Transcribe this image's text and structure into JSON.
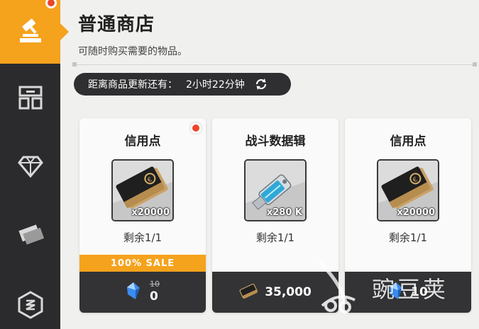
{
  "sidebar": {
    "items": [
      {
        "icon": "bid-hammer-icon",
        "active": true,
        "has_notification": true
      },
      {
        "icon": "store-icon",
        "active": false
      },
      {
        "icon": "diamond-icon",
        "active": false
      },
      {
        "icon": "tickets-icon",
        "active": false
      },
      {
        "icon": "hex-badge-icon",
        "active": false
      }
    ]
  },
  "header": {
    "title": "普通商店",
    "subtitle": "可随时购买需要的物品。"
  },
  "timer": {
    "label": "距离商品更新还有：",
    "value": "2小时22分钟",
    "icon": "refresh-icon"
  },
  "items": [
    {
      "name": "信用点",
      "quantity": "x20000",
      "remaining": "剩余1/1",
      "sale_label": "100% SALE",
      "original_price": "10",
      "price": "0",
      "currency_icon": "blue-crystal-icon",
      "has_notification": true
    },
    {
      "name": "战斗数据辑",
      "quantity": "x280 K",
      "remaining": "剩余1/1",
      "price": "35,000",
      "currency_icon": "credit-card-icon"
    },
    {
      "name": "信用点",
      "quantity": "x20000",
      "remaining": "剩余1/1",
      "price": "10",
      "currency_icon": "blue-crystal-icon"
    }
  ],
  "watermark": {
    "text": "豌豆荚"
  },
  "colors": {
    "accent": "#f5a21d",
    "sidebar": "#2b2b2d",
    "price_bar": "#333335",
    "notification": "#e9462c"
  }
}
